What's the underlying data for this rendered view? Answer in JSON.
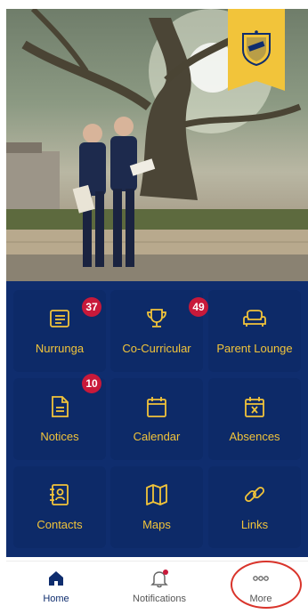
{
  "colors": {
    "navy": "#0f2d6e",
    "gold": "#f2c43a",
    "badge": "#c8193a",
    "annotation": "#d9342b"
  },
  "hero": {
    "crest_icon": "school-crest-icon"
  },
  "tiles": [
    {
      "label": "Nurrunga",
      "icon": "newspaper-icon",
      "badge": "37"
    },
    {
      "label": "Co-Curricular",
      "icon": "trophy-icon",
      "badge": "49"
    },
    {
      "label": "Parent Lounge",
      "icon": "sofa-icon",
      "badge": ""
    },
    {
      "label": "Notices",
      "icon": "document-icon",
      "badge": "10"
    },
    {
      "label": "Calendar",
      "icon": "calendar-icon",
      "badge": ""
    },
    {
      "label": "Absences",
      "icon": "calendar-x-icon",
      "badge": ""
    },
    {
      "label": "Contacts",
      "icon": "contact-book-icon",
      "badge": ""
    },
    {
      "label": "Maps",
      "icon": "map-icon",
      "badge": ""
    },
    {
      "label": "Links",
      "icon": "link-icon",
      "badge": ""
    }
  ],
  "nav": [
    {
      "label": "Home",
      "icon": "home-icon",
      "active": true
    },
    {
      "label": "Notifications",
      "icon": "bell-icon",
      "active": false
    },
    {
      "label": "More",
      "icon": "more-dots-icon",
      "active": false
    }
  ]
}
